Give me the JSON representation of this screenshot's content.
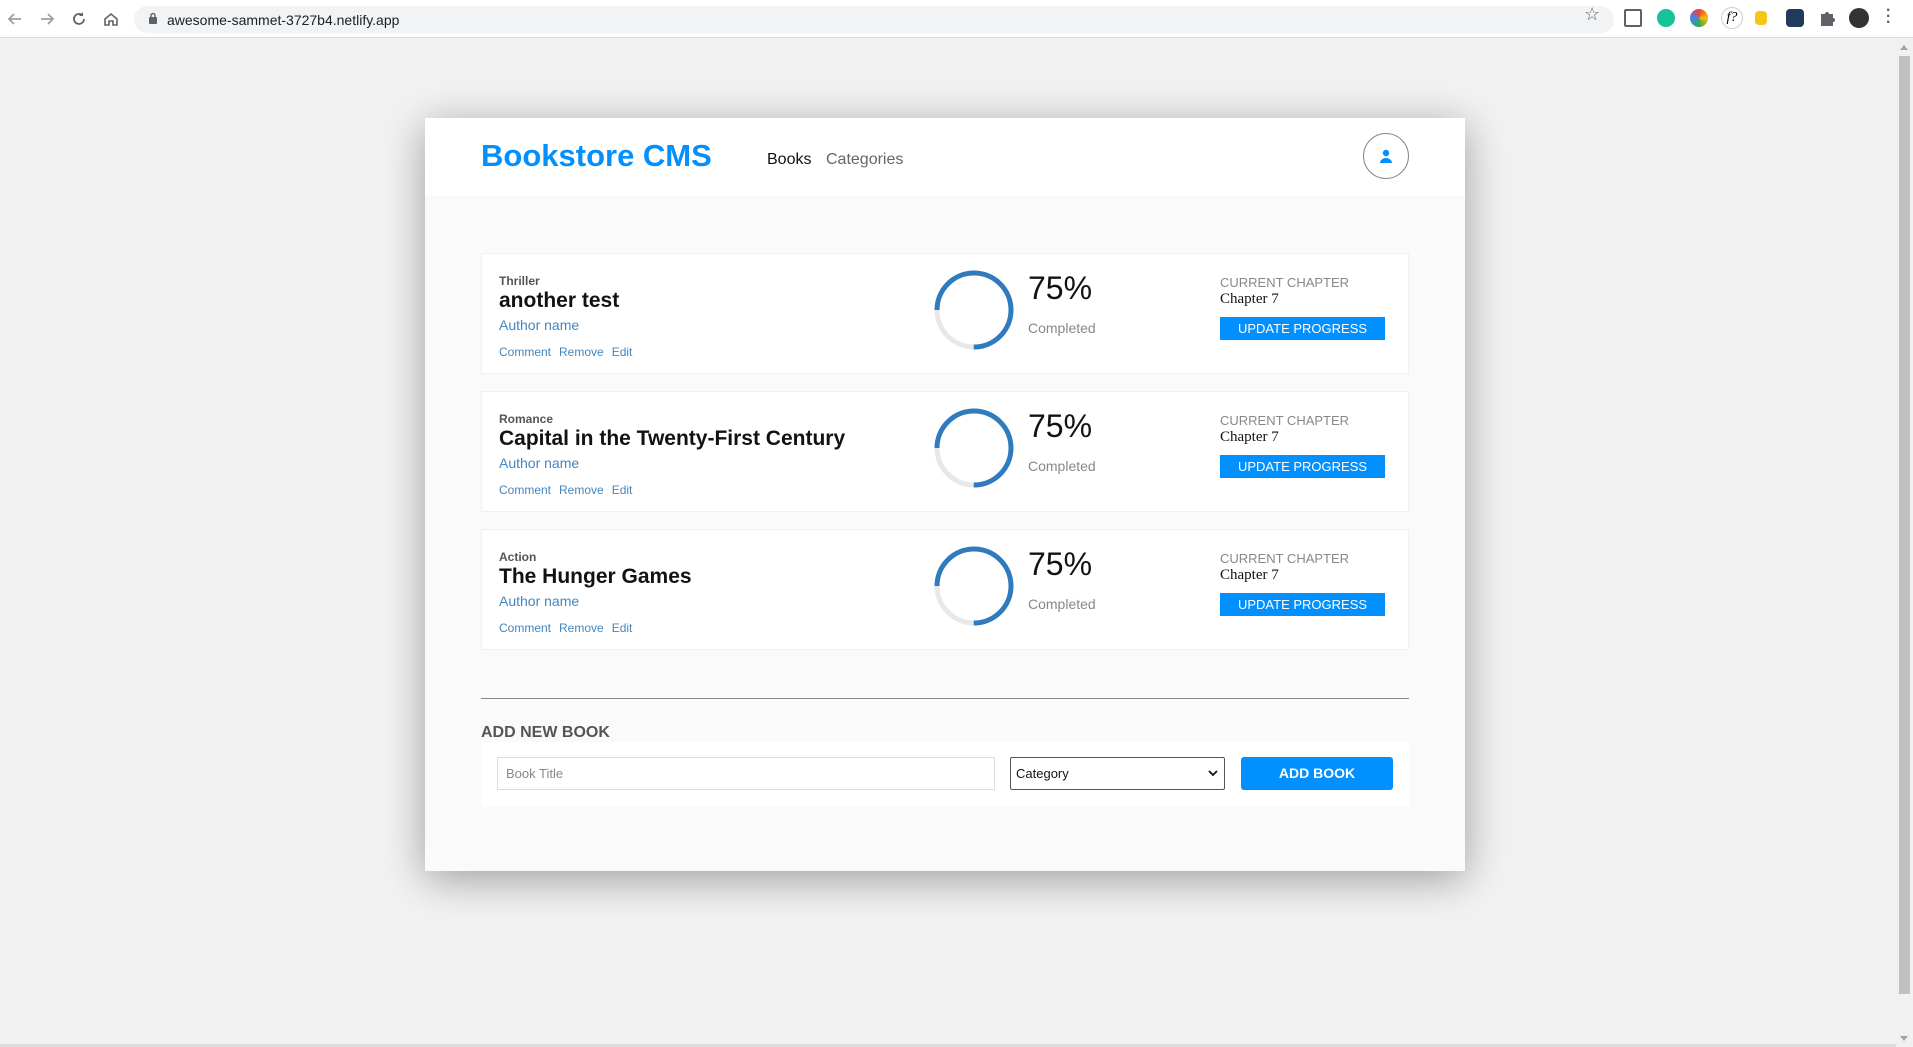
{
  "browser": {
    "url": "awesome-sammet-3727b4.netlify.app"
  },
  "header": {
    "logo": "Bookstore CMS",
    "nav_books": "Books",
    "nav_categories": "Categories"
  },
  "books": [
    {
      "category": "Thriller",
      "title": "another test",
      "author": "Author name",
      "actions": [
        "Comment",
        "Remove",
        "Edit"
      ],
      "percent": "75%",
      "progress": 0.75,
      "completed_label": "Completed",
      "chapter_label": "CURRENT CHAPTER",
      "chapter": "Chapter 7",
      "update_label": "UPDATE PROGRESS"
    },
    {
      "category": "Romance",
      "title": "Capital in the Twenty-First Century",
      "author": "Author name",
      "actions": [
        "Comment",
        "Remove",
        "Edit"
      ],
      "percent": "75%",
      "progress": 0.75,
      "completed_label": "Completed",
      "chapter_label": "CURRENT CHAPTER",
      "chapter": "Chapter 7",
      "update_label": "UPDATE PROGRESS"
    },
    {
      "category": "Action",
      "title": "The Hunger Games",
      "author": "Author name",
      "actions": [
        "Comment",
        "Remove",
        "Edit"
      ],
      "percent": "75%",
      "progress": 0.75,
      "completed_label": "Completed",
      "chapter_label": "CURRENT CHAPTER",
      "chapter": "Chapter 7",
      "update_label": "UPDATE PROGRESS"
    }
  ],
  "add_book": {
    "heading": "ADD NEW BOOK",
    "title_placeholder": "Book Title",
    "category_selected": "Category",
    "button_label": "ADD BOOK"
  },
  "colors": {
    "accent": "#0290ff",
    "link": "#4386bf",
    "progress": "#307bbe",
    "track": "#e8e8e8"
  }
}
